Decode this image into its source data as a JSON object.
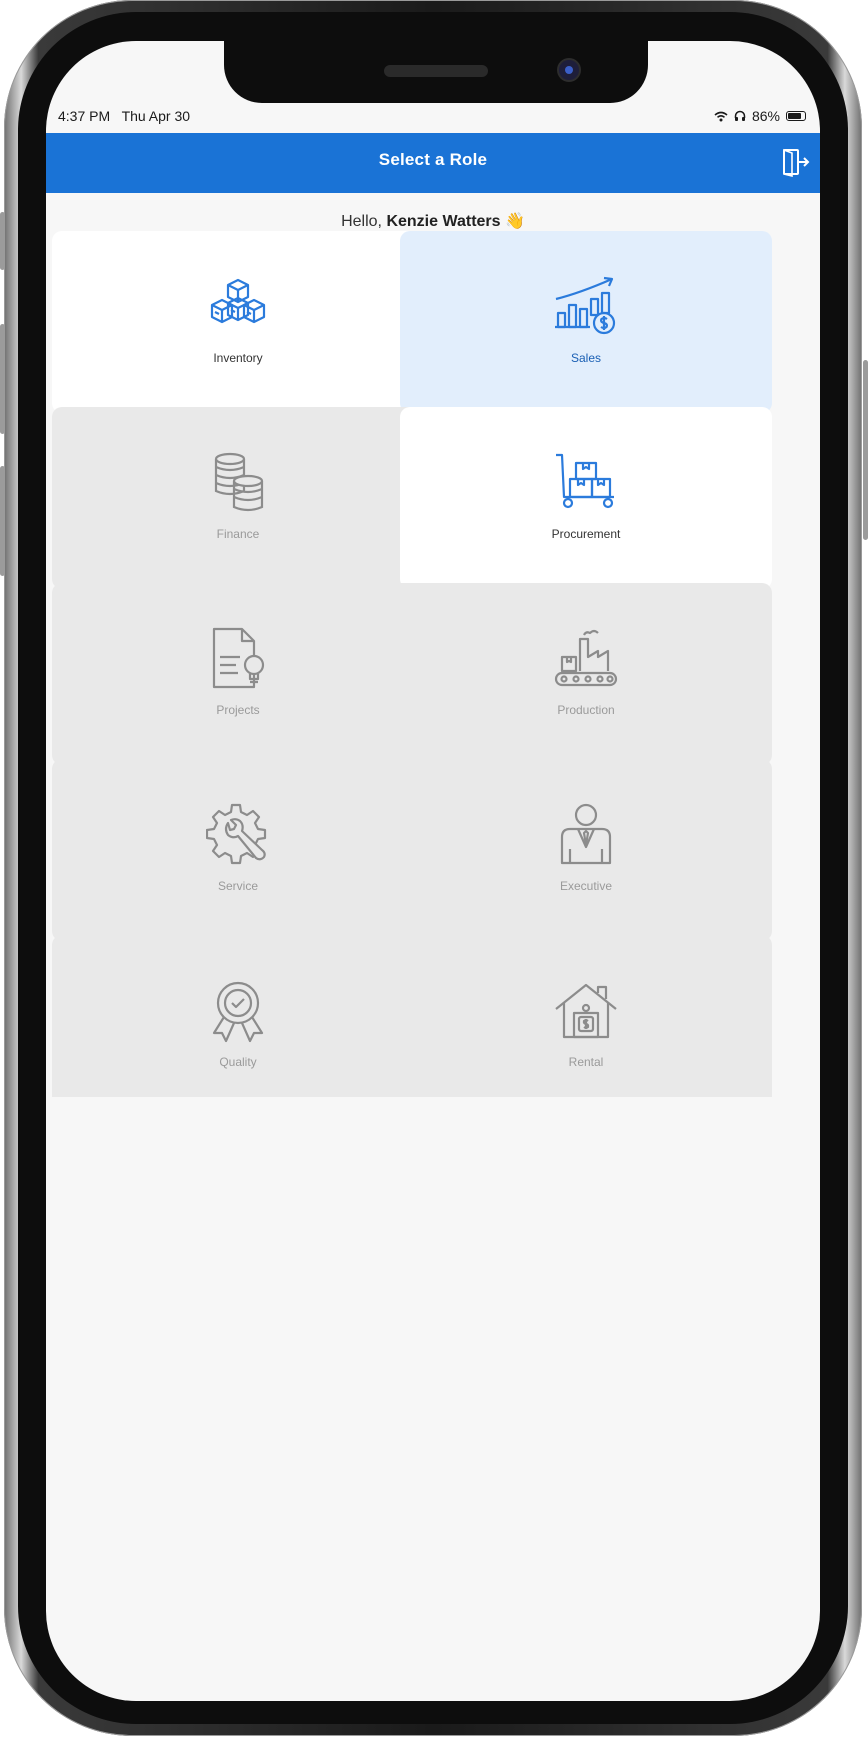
{
  "status_bar": {
    "time": "4:37 PM",
    "date": "Thu Apr 30",
    "battery": "86%",
    "battery_level": 0.86,
    "icons": [
      "wifi-icon",
      "headphones-icon",
      "battery-icon"
    ]
  },
  "navbar": {
    "title": "Select a Role",
    "logout_icon": "logout-icon"
  },
  "greeting": {
    "prefix": "Hello, ",
    "name": "Kenzie Watters",
    "emoji": "👋"
  },
  "roles": [
    {
      "label": "Inventory",
      "icon": "boxes-icon",
      "state": "enabled"
    },
    {
      "label": "Sales",
      "icon": "sales-chart-icon",
      "state": "selected"
    },
    {
      "label": "Finance",
      "icon": "coins-icon",
      "state": "disabled"
    },
    {
      "label": "Procurement",
      "icon": "hand-truck-icon",
      "state": "enabled"
    },
    {
      "label": "Projects",
      "icon": "document-idea-icon",
      "state": "disabled"
    },
    {
      "label": "Production",
      "icon": "factory-icon",
      "state": "disabled"
    },
    {
      "label": "Service",
      "icon": "gear-wrench-icon",
      "state": "disabled"
    },
    {
      "label": "Executive",
      "icon": "businessman-icon",
      "state": "disabled"
    },
    {
      "label": "Quality",
      "icon": "quality-badge-icon",
      "state": "disabled"
    },
    {
      "label": "Rental",
      "icon": "rental-house-icon",
      "state": "disabled"
    }
  ],
  "colors": {
    "accent": "#1a73d6",
    "selected_tile": "#e2eefc",
    "disabled_tile": "#e9e9e9",
    "icon_active": "#2b7bdc",
    "icon_disabled": "#8c8c8c"
  }
}
